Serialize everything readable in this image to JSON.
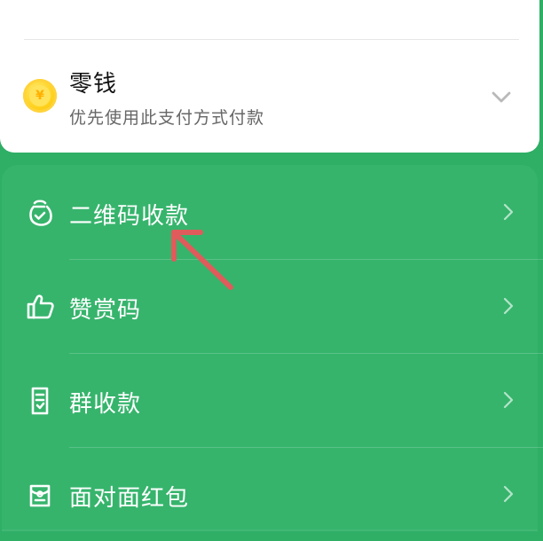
{
  "wallet": {
    "title": "零钱",
    "subtitle": "优先使用此支付方式付款",
    "icon": "coin-icon",
    "coin_symbol": "¥"
  },
  "menu": {
    "items": [
      {
        "label": "二维码收款",
        "icon": "money-bag-icon"
      },
      {
        "label": "赞赏码",
        "icon": "thumbs-up-icon"
      },
      {
        "label": "群收款",
        "icon": "receipt-icon"
      },
      {
        "label": "面对面红包",
        "icon": "red-envelope-icon"
      }
    ]
  },
  "colors": {
    "green_bg": "#2fae66",
    "panel": "#36b46c",
    "arrow": "#e05b5b"
  }
}
